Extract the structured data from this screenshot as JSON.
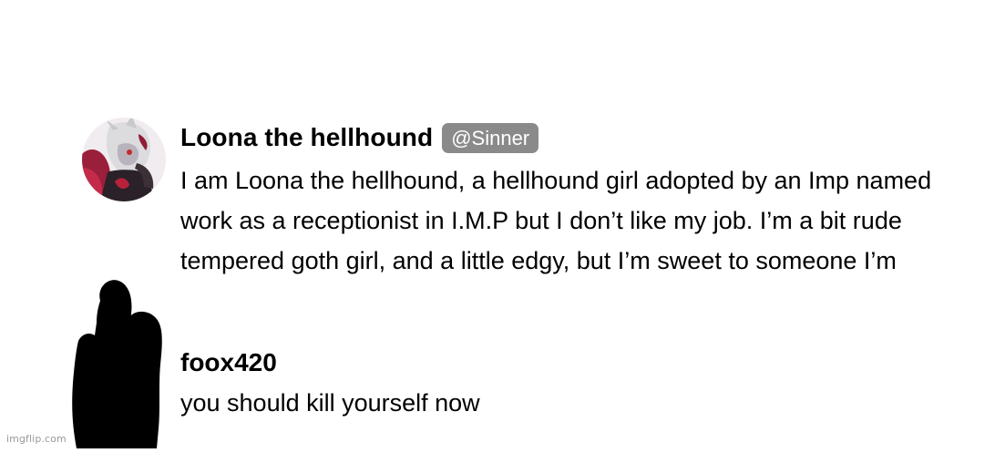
{
  "posts": [
    {
      "author": "Loona the hellhound",
      "badge": "@Sinner",
      "avatar_icon": "character-avatar",
      "message_lines": [
        "I am Loona the hellhound, a hellhound girl adopted by an Imp named",
        "work as a receptionist in I.M.P but I don’t like my job. I’m a bit rude",
        "tempered goth girl, and a little edgy, but I’m sweet to someone I’m"
      ]
    },
    {
      "author": "foox420",
      "avatar_icon": "silhouette-hand-icon",
      "message": "you should kill yourself now"
    }
  ],
  "watermark": "imgflip.com",
  "colors": {
    "badge_bg": "#8a8a8a",
    "badge_text": "#ffffff",
    "text": "#000000",
    "background": "#ffffff"
  }
}
